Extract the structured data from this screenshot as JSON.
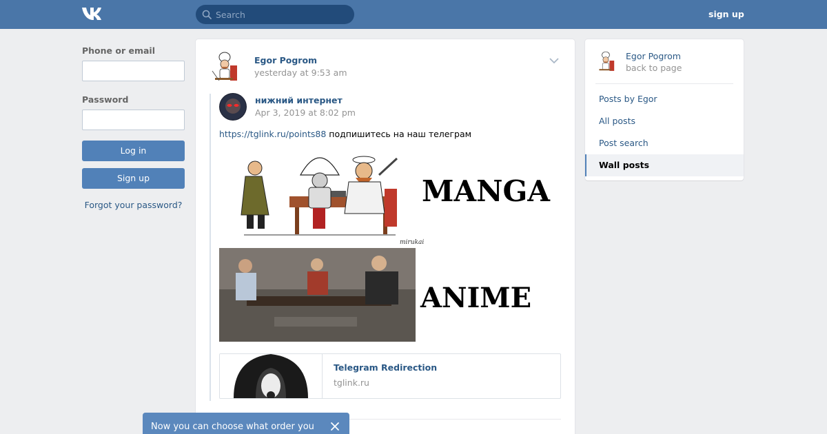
{
  "header": {
    "search_placeholder": "Search",
    "signup_label": "sign up",
    "accent_color": "#4a76a8"
  },
  "login": {
    "phone_label": "Phone or email",
    "password_label": "Password",
    "login_button": "Log in",
    "signup_button": "Sign up",
    "forgot_link": "Forgot your password?"
  },
  "post": {
    "author": "Egor Pogrom",
    "date": "yesterday at 9:53 am",
    "repost": {
      "author": "нижний интернет",
      "date": "Apr 3, 2019 at 8:02 pm",
      "link_url": "https://tglink.ru/points88",
      "text": " подпишитесь на наш телеграм",
      "image": {
        "caption_top": "MANGA",
        "caption_bottom": "ANIME",
        "artist_signature": "mirukai"
      },
      "link_card": {
        "title": "Telegram Redirection",
        "domain": "tglink.ru"
      }
    }
  },
  "sidebar": {
    "owner_name": "Egor Pogrom",
    "owner_sub": "back to page",
    "items": [
      {
        "label": "Posts by Egor",
        "active": false
      },
      {
        "label": "All posts",
        "active": false
      },
      {
        "label": "Post search",
        "active": false
      },
      {
        "label": "Wall posts",
        "active": true
      }
    ]
  },
  "toast": {
    "text": "Now you can choose what order you"
  }
}
